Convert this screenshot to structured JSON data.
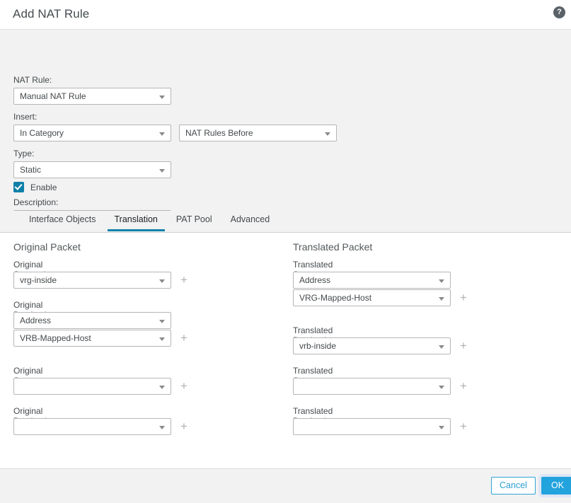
{
  "dialog": {
    "title": "Add NAT Rule",
    "help_icon": "help-question-icon"
  },
  "upper_form": {
    "nat_rule": {
      "label": "NAT Rule:",
      "value": "Manual NAT Rule"
    },
    "insert": {
      "label": "Insert:",
      "value": "In Category",
      "value2": "NAT Rules Before"
    },
    "type": {
      "label": "Type:",
      "value": "Static"
    },
    "enable": {
      "label": "Enable",
      "checked": true
    },
    "description": {
      "label": "Description:",
      "value": "",
      "placeholder": ""
    }
  },
  "tabs": [
    {
      "label": "Interface Objects",
      "active": false
    },
    {
      "label": "Translation",
      "active": true
    },
    {
      "label": "PAT Pool",
      "active": false
    },
    {
      "label": "Advanced",
      "active": false
    }
  ],
  "original_packet": {
    "title": "Original Packet",
    "fields": [
      {
        "label": "Original Source:*",
        "value": "vrg-inside",
        "has_plus": true
      },
      {
        "label": "Original Destination:",
        "value": "Address",
        "has_plus": false
      },
      {
        "label": "",
        "value": "VRB-Mapped-Host",
        "has_plus": true
      },
      {
        "label": "Original Source Port:",
        "value": "",
        "has_plus": true
      },
      {
        "label": "Original Destination Port:",
        "value": "",
        "has_plus": true
      }
    ]
  },
  "translated_packet": {
    "title": "Translated Packet",
    "fields": [
      {
        "label": "Translated Source:",
        "value": "Address",
        "has_plus": false
      },
      {
        "label": "",
        "value": "VRG-Mapped-Host",
        "has_plus": true
      },
      {
        "label": "Translated Destination:",
        "value": "vrb-inside",
        "has_plus": true
      },
      {
        "label": "Translated Source Port:",
        "value": "",
        "has_plus": true
      },
      {
        "label": "Translated Destination Port:",
        "value": "",
        "has_plus": true
      }
    ]
  },
  "footer": {
    "cancel_label": "Cancel",
    "ok_label": "OK"
  },
  "colors": {
    "accent_blue": "#1282ab",
    "checkbox_blue": "#0e80a8",
    "ok_button": "#23a3dd",
    "cancel_border": "#2fa4d4",
    "body_gray": "#f2f2f2"
  }
}
